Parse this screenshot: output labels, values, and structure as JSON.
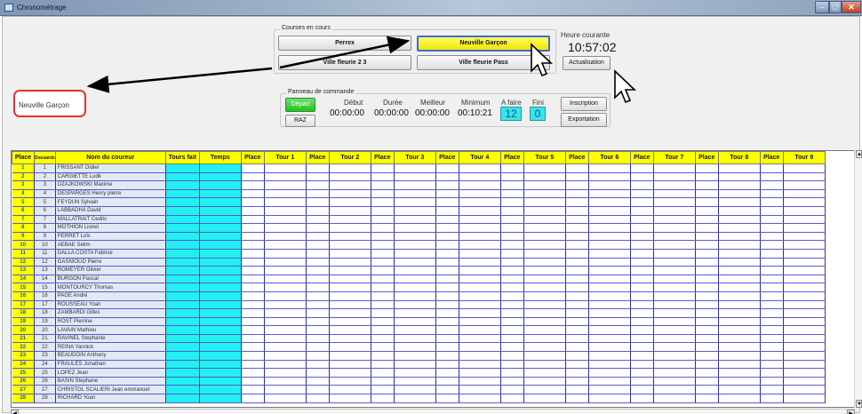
{
  "window": {
    "title": "Chronométrage"
  },
  "courses": {
    "group_title": "Courses en cours",
    "buttons": [
      "Perrex",
      "Neuville Garçon",
      "Ville fleurie 2 3",
      "Ville fleurie Pass"
    ],
    "active": "Neuville Garçon",
    "colors": {
      "active_fill": "#ffff00",
      "active_border": "#3a6bd6"
    }
  },
  "clock": {
    "label": "Heure courante",
    "time": "10:57:02",
    "button": "Actualisation"
  },
  "callout": {
    "text": "Neuville Garçon",
    "border_color": "#e8312b"
  },
  "panel": {
    "title": "Panneau de commande",
    "depart": "Départ",
    "raz": "RAZ",
    "stats": [
      {
        "label": "Début",
        "value": "00:00:00"
      },
      {
        "label": "Durée",
        "value": "00:00:00"
      },
      {
        "label": "Meilleur",
        "value": "00:00:00"
      },
      {
        "label": "Minimum",
        "value": "00:10:21"
      }
    ],
    "afaire": {
      "label": "A faire",
      "value": "12"
    },
    "fini": {
      "label": "Fini",
      "value": "0"
    },
    "inscription": "Inscription",
    "exportation": "Exportation"
  },
  "grid": {
    "headers": [
      "Place",
      "Dossards",
      "Nom du coureur",
      "Tours fait",
      "Temps",
      "Place",
      "Tour 1",
      "Place",
      "Tour 2",
      "Place",
      "Tour 3",
      "Place",
      "Tour 4",
      "Place",
      "Tour 5",
      "Place",
      "Tour 6",
      "Place",
      "Tour 7",
      "Place",
      "Tour 8",
      "Place",
      "Tour 9"
    ],
    "header_color": "#ffff00",
    "rows": [
      [
        "1",
        "1",
        "FRISSANT Didier"
      ],
      [
        "2",
        "2",
        "CARGIETTE Ludk"
      ],
      [
        "3",
        "3",
        "DZAJKOWSKI Maxime"
      ],
      [
        "4",
        "4",
        "DESPARGES Henry pierre"
      ],
      [
        "5",
        "5",
        "FEYDUN Sylvain"
      ],
      [
        "6",
        "6",
        "LABBADHA David"
      ],
      [
        "7",
        "7",
        "MALLATRAIT Cedric"
      ],
      [
        "8",
        "8",
        "MOTHION Lionel"
      ],
      [
        "9",
        "9",
        "PERRET Loïc"
      ],
      [
        "10",
        "10",
        "AEBAE Selim"
      ],
      [
        "11",
        "11",
        "DALLA COSTA Fabrice"
      ],
      [
        "12",
        "12",
        "GASNIOUD Pierre"
      ],
      [
        "13",
        "13",
        "ROMEYER Olivier"
      ],
      [
        "14",
        "14",
        "BURGON Pascal"
      ],
      [
        "15",
        "15",
        "MONTOURCY Thomas"
      ],
      [
        "16",
        "16",
        "PAGE André"
      ],
      [
        "17",
        "17",
        "ROUSSEAU Yoan"
      ],
      [
        "18",
        "18",
        "ZAMBARDI Gilles"
      ],
      [
        "19",
        "19",
        "ROST Pierrine"
      ],
      [
        "20",
        "20",
        "LAVAIN Mathieu"
      ],
      [
        "21",
        "21",
        "RAVINEL Stephanie"
      ],
      [
        "22",
        "22",
        "REINA Yannick"
      ],
      [
        "23",
        "23",
        "BEAUDOIN Anthony"
      ],
      [
        "24",
        "24",
        "FRAULES Jonathan"
      ],
      [
        "25",
        "25",
        "LOPEZ Jean"
      ],
      [
        "26",
        "26",
        "BASIN Stephane"
      ],
      [
        "27",
        "27",
        "CHRISTOL SCALIERI Jean emmanuel"
      ],
      [
        "28",
        "28",
        "RICHARD Yoan"
      ]
    ]
  }
}
